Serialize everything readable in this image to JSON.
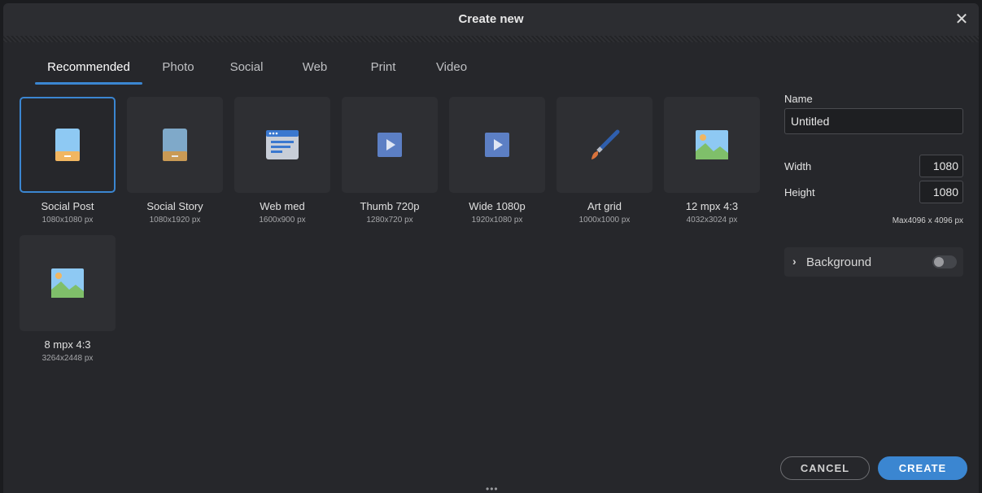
{
  "dialog": {
    "title": "Create new"
  },
  "tabs": [
    {
      "label": "Recommended",
      "active": true
    },
    {
      "label": "Photo"
    },
    {
      "label": "Social"
    },
    {
      "label": "Web"
    },
    {
      "label": "Print"
    },
    {
      "label": "Video"
    }
  ],
  "presets": [
    {
      "label": "Social Post",
      "dims": "1080x1080 px",
      "icon": "phone-icon",
      "selected": true
    },
    {
      "label": "Social Story",
      "dims": "1080x1920 px",
      "icon": "phone-icon"
    },
    {
      "label": "Web med",
      "dims": "1600x900 px",
      "icon": "browser-window-icon"
    },
    {
      "label": "Thumb 720p",
      "dims": "1280x720 px",
      "icon": "video-play-icon"
    },
    {
      "label": "Wide 1080p",
      "dims": "1920x1080 px",
      "icon": "video-play-icon"
    },
    {
      "label": "Art grid",
      "dims": "1000x1000 px",
      "icon": "paintbrush-icon"
    },
    {
      "label": "12 mpx 4:3",
      "dims": "4032x3024 px",
      "icon": "landscape-photo-icon"
    },
    {
      "label": "8 mpx 4:3",
      "dims": "3264x2448 px",
      "icon": "landscape-photo-icon"
    }
  ],
  "settings": {
    "name_label": "Name",
    "name_value": "Untitled",
    "width_label": "Width",
    "width_value": "1080",
    "height_label": "Height",
    "height_value": "1080",
    "max_note": "Max4096 x 4096 px",
    "background_label": "Background",
    "background_enabled": false
  },
  "buttons": {
    "cancel": "CANCEL",
    "create": "CREATE"
  },
  "colors": {
    "accent": "#3b86d1",
    "panel": "#26272b",
    "card": "#2e2f33"
  }
}
